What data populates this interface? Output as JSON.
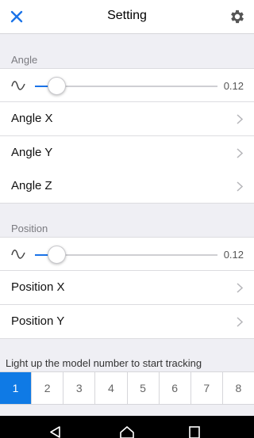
{
  "header": {
    "title": "Setting",
    "close_icon": "close-icon",
    "settings_icon": "gear-icon"
  },
  "angle": {
    "section_label": "Angle",
    "slider": {
      "value_text": "0.12",
      "fraction": 0.12,
      "icon": "wave-icon"
    },
    "items": [
      {
        "label": "Angle X"
      },
      {
        "label": "Angle Y"
      },
      {
        "label": "Angle Z"
      }
    ]
  },
  "position": {
    "section_label": "Position",
    "slider": {
      "value_text": "0.12",
      "fraction": 0.12,
      "icon": "wave-icon"
    },
    "items": [
      {
        "label": "Position X"
      },
      {
        "label": "Position Y"
      }
    ]
  },
  "tracking": {
    "hint": "Light up the model number to start tracking",
    "numbers": [
      "1",
      "2",
      "3",
      "4",
      "5",
      "6",
      "7",
      "8"
    ],
    "selected": "1"
  },
  "colors": {
    "accent": "#0f7ae5",
    "background": "#efeff4"
  },
  "system_nav": {
    "back_icon": "back-icon",
    "home_icon": "home-icon",
    "recents_icon": "recents-icon"
  }
}
